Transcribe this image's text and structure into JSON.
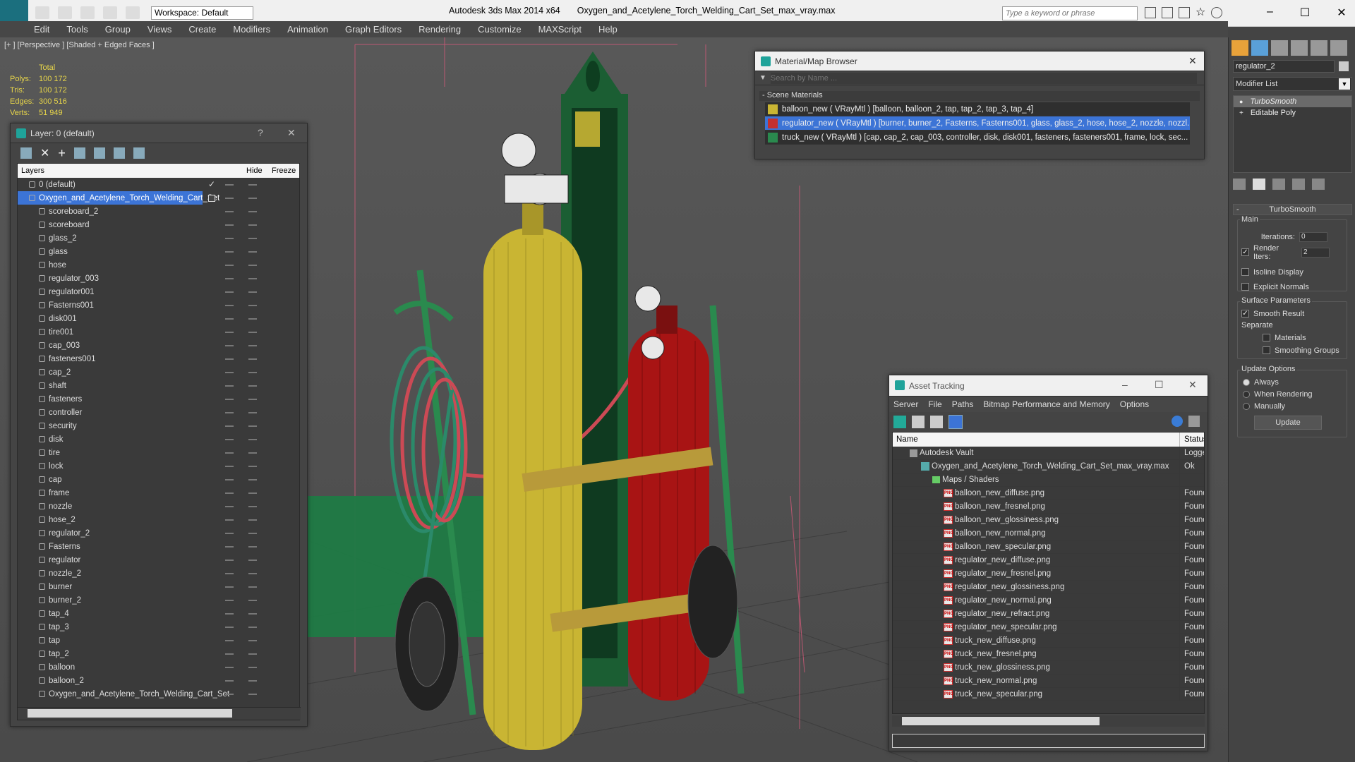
{
  "app": {
    "title": "Autodesk 3ds Max  2014 x64",
    "file": "Oxygen_and_Acetylene_Torch_Welding_Cart_Set_max_vray.max",
    "workspace": "Workspace: Default",
    "search_placeholder": "Type a keyword or phrase"
  },
  "menu": [
    "Edit",
    "Tools",
    "Group",
    "Views",
    "Create",
    "Modifiers",
    "Animation",
    "Graph Editors",
    "Rendering",
    "Customize",
    "MAXScript",
    "Help"
  ],
  "viewport": {
    "label": "[+ ] [Perspective ] [Shaded + Edged Faces ]",
    "stats_header": "Total",
    "stats": [
      {
        "label": "Polys:",
        "value": "100 172"
      },
      {
        "label": "Tris:",
        "value": "100 172"
      },
      {
        "label": "Edges:",
        "value": "300 516"
      },
      {
        "label": "Verts:",
        "value": "51 949"
      }
    ]
  },
  "layer_window": {
    "title": "Layer: 0 (default)",
    "help": "?",
    "close": "✕",
    "col_layers": "Layers",
    "col_hide": "Hide",
    "col_freeze": "Freeze",
    "top_layers": [
      "0 (default)",
      "Oxygen_and_Acetylene_Torch_Welding_Cart_Set"
    ],
    "objects": [
      "scoreboard_2",
      "scoreboard",
      "glass_2",
      "glass",
      "hose",
      "regulator_003",
      "regulator001",
      "Fasterns001",
      "disk001",
      "tire001",
      "cap_003",
      "fasteners001",
      "cap_2",
      "shaft",
      "fasteners",
      "controller",
      "security",
      "disk",
      "tire",
      "lock",
      "cap",
      "frame",
      "nozzle",
      "hose_2",
      "regulator_2",
      "Fasterns",
      "regulator",
      "nozzle_2",
      "burner",
      "burner_2",
      "tap_4",
      "tap_3",
      "tap",
      "tap_2",
      "balloon",
      "balloon_2",
      "Oxygen_and_Acetylene_Torch_Welding_Cart_Set"
    ]
  },
  "material_browser": {
    "title": "Material/Map Browser",
    "search_placeholder": "Search by Name ...",
    "section": "- Scene Materials",
    "materials": [
      "balloon_new  ( VRayMtl ) [balloon, balloon_2, tap, tap_2, tap_3, tap_4]",
      "regulator_new  ( VRayMtl ) [burner, burner_2, Fasterns, Fasterns001, glass, glass_2, hose, hose_2, nozzle, nozzl...",
      "truck_new  ( VRayMtl ) [cap, cap_2, cap_003, controller, disk, disk001, fasteners, fasteners001, frame, lock, sec..."
    ]
  },
  "asset_tracking": {
    "title": "Asset Tracking",
    "menu": [
      "Server",
      "File",
      "Paths",
      "Bitmap Performance and Memory",
      "Options"
    ],
    "col_name": "Name",
    "col_status": "Status",
    "vault": {
      "name": "Autodesk Vault",
      "status": "Logged"
    },
    "file": {
      "name": "Oxygen_and_Acetylene_Torch_Welding_Cart_Set_max_vray.max",
      "status": "Ok"
    },
    "maps_folder": "Maps / Shaders",
    "maps": [
      {
        "name": "balloon_new_diffuse.png",
        "status": "Found"
      },
      {
        "name": "balloon_new_fresnel.png",
        "status": "Found"
      },
      {
        "name": "balloon_new_glossiness.png",
        "status": "Found"
      },
      {
        "name": "balloon_new_normal.png",
        "status": "Found"
      },
      {
        "name": "balloon_new_specular.png",
        "status": "Found"
      },
      {
        "name": "regulator_new_diffuse.png",
        "status": "Found"
      },
      {
        "name": "regulator_new_fresnel.png",
        "status": "Found"
      },
      {
        "name": "regulator_new_glossiness.png",
        "status": "Found"
      },
      {
        "name": "regulator_new_normal.png",
        "status": "Found"
      },
      {
        "name": "regulator_new_refract.png",
        "status": "Found"
      },
      {
        "name": "regulator_new_specular.png",
        "status": "Found"
      },
      {
        "name": "truck_new_diffuse.png",
        "status": "Found"
      },
      {
        "name": "truck_new_fresnel.png",
        "status": "Found"
      },
      {
        "name": "truck_new_glossiness.png",
        "status": "Found"
      },
      {
        "name": "truck_new_normal.png",
        "status": "Found"
      },
      {
        "name": "truck_new_specular.png",
        "status": "Found"
      }
    ]
  },
  "command_panel": {
    "object_name": "regulator_2",
    "modifier_list": "Modifier List",
    "stack": [
      "TurboSmooth",
      "Editable Poly"
    ],
    "rollout_title": "TurboSmooth",
    "main_label": "Main",
    "iterations_label": "Iterations:",
    "iterations_value": "0",
    "render_iters_label": "Render Iters:",
    "render_iters_value": "2",
    "isoline": "Isoline Display",
    "explicit_normals": "Explicit Normals",
    "surface_params": "Surface Parameters",
    "smooth_result": "Smooth Result",
    "separate": "Separate",
    "materials": "Materials",
    "smoothing_groups": "Smoothing Groups",
    "update_options": "Update Options",
    "always": "Always",
    "when_rendering": "When Rendering",
    "manually": "Manually",
    "update_button": "Update"
  },
  "colors": {
    "selection": "#3c74d6",
    "yellow_cylinder": "#c9b533",
    "red_cylinder": "#a81414",
    "cart_green": "#1f7a44",
    "accent": "#1fa39a"
  }
}
